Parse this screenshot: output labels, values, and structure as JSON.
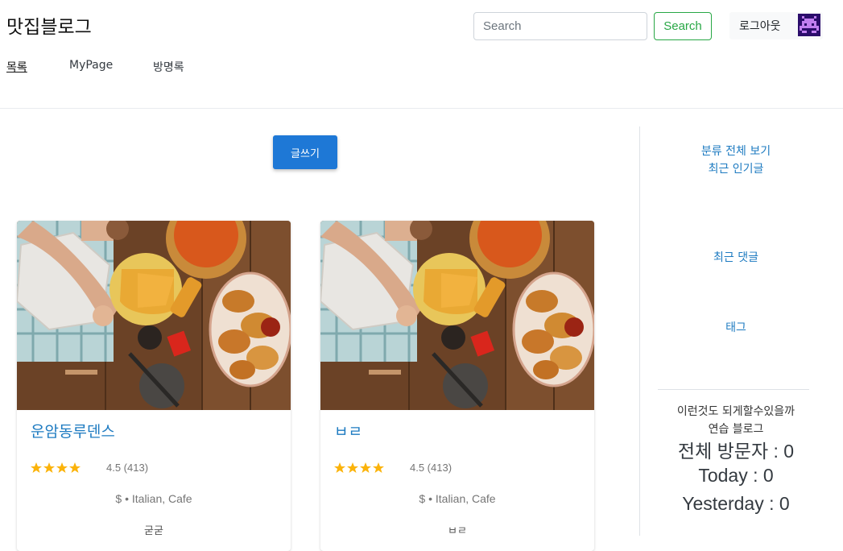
{
  "header": {
    "brand": "맛집블로그",
    "search_placeholder": "Search",
    "search_button": "Search",
    "logout_button": "로그아웃"
  },
  "nav": {
    "items": [
      {
        "label": "목록",
        "active": true
      },
      {
        "label": "MyPage",
        "active": false
      },
      {
        "label": "방명록",
        "active": false
      }
    ]
  },
  "main": {
    "write_button": "글쓰기",
    "cards": [
      {
        "title": "운암동루덴스",
        "rating": "4.5 (413)",
        "rating_value": 4.5,
        "meta": "$ • Italian, Cafe",
        "description": "굳굳"
      },
      {
        "title": "ㅂㄹ",
        "rating": "4.5 (413)",
        "rating_value": 4.5,
        "meta": "$ • Italian, Cafe",
        "description": "ㅂㄹ"
      }
    ]
  },
  "sidebar": {
    "category_link": "분류 전체 보기",
    "popular_link": "최근 인기글",
    "comments_link": "최근 댓글",
    "tags_link": "태그",
    "note_line1": "이런것도 되게할수있을까",
    "note_line2": "연습 블로그",
    "total_visitors": "전체 방문자 : 0",
    "today": "Today : 0",
    "yesterday": "Yesterday : 0"
  },
  "colors": {
    "accent": "#1e78d6",
    "link": "#1e7bc1",
    "success": "#28a745",
    "star": "#fbb30b"
  }
}
